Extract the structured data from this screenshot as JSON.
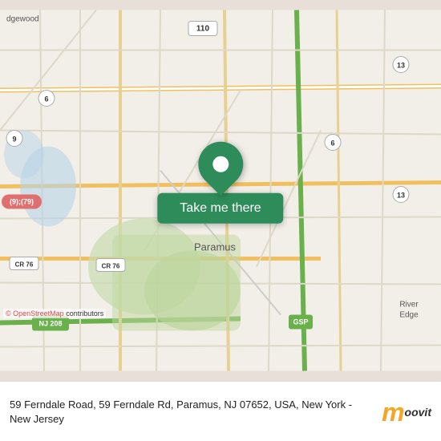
{
  "map": {
    "background_color": "#e8e0d8",
    "center_label": "Paramus",
    "attribution": "© OpenStreetMap contributors"
  },
  "cta": {
    "button_label": "Take me there",
    "pin_color": "#2d8c5a",
    "button_bg": "#2d8c5a"
  },
  "footer": {
    "address": "59 Ferndale Road, 59 Ferndale Rd, Paramus, NJ 07652, USA, New York - New Jersey",
    "logo_m": "m",
    "logo_text": "oovit"
  }
}
